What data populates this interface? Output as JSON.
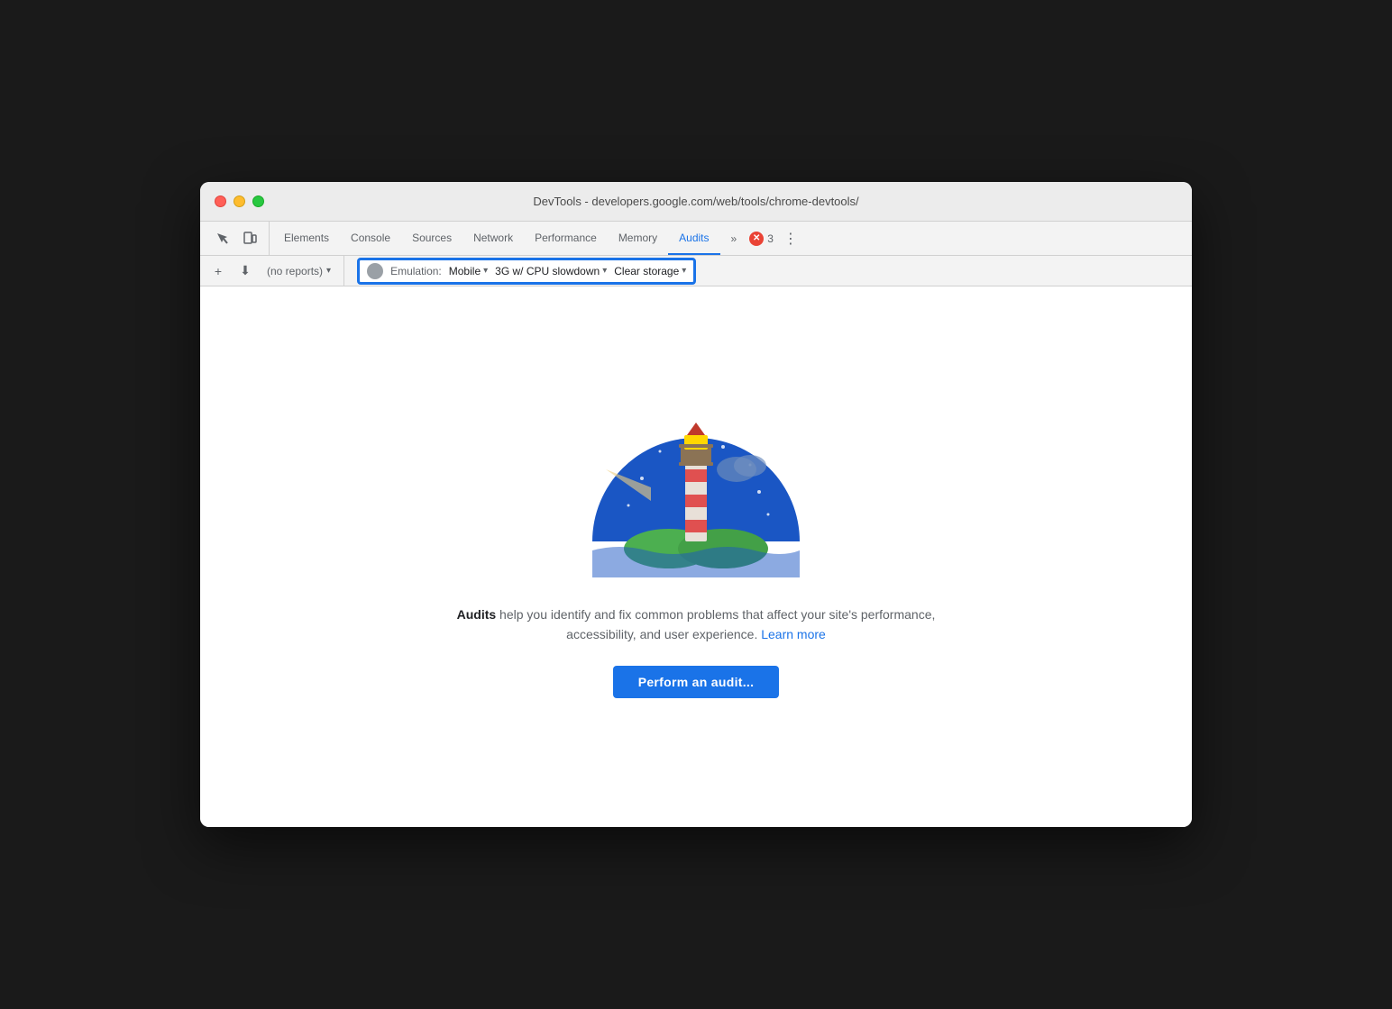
{
  "window": {
    "title": "DevTools - developers.google.com/web/tools/chrome-devtools/"
  },
  "tabs": {
    "items": [
      {
        "label": "Elements",
        "active": false
      },
      {
        "label": "Console",
        "active": false
      },
      {
        "label": "Sources",
        "active": false
      },
      {
        "label": "Network",
        "active": false
      },
      {
        "label": "Performance",
        "active": false
      },
      {
        "label": "Memory",
        "active": false
      },
      {
        "label": "Audits",
        "active": true
      }
    ],
    "more_label": "»",
    "error_count": "3"
  },
  "toolbar": {
    "add_label": "+",
    "import_label": "⬇",
    "reports_placeholder": "(no reports)",
    "emulation_label": "Emulation:",
    "mobile_label": "Mobile",
    "network_label": "3G w/ CPU slowdown",
    "clear_storage_label": "Clear storage"
  },
  "content": {
    "description_bold": "Audits",
    "description_text": " help you identify and fix common problems that affect your site's performance, accessibility, and user experience.",
    "learn_more_label": "Learn more",
    "perform_audit_label": "Perform an audit..."
  }
}
